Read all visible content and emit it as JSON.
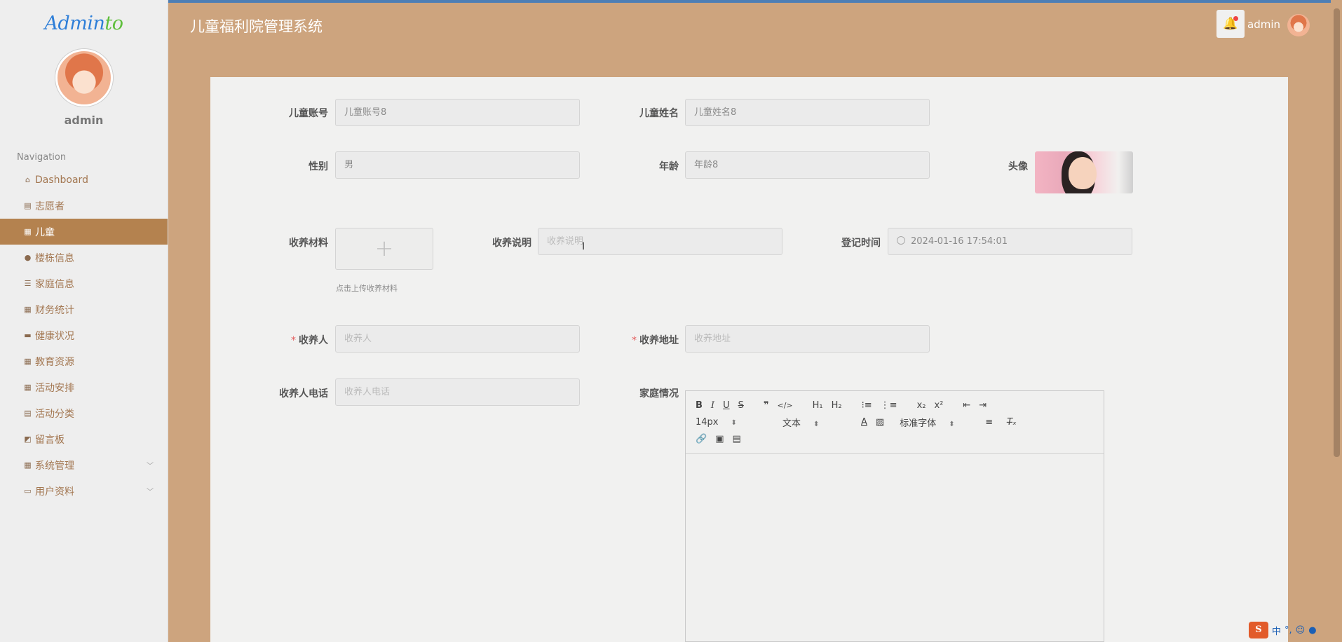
{
  "sidebar": {
    "logo_main": "Admin",
    "logo_suffix": "to",
    "user_name": "admin",
    "nav_title": "Navigation",
    "items": [
      {
        "label": "Dashboard",
        "icon": "home-icon"
      },
      {
        "label": "志愿者",
        "icon": "clipboard-icon"
      },
      {
        "label": "儿童",
        "icon": "grid-icon",
        "active": true
      },
      {
        "label": "楼栋信息",
        "icon": "user-icon"
      },
      {
        "label": "家庭信息",
        "icon": "sliders-icon"
      },
      {
        "label": "财务统计",
        "icon": "grid-icon"
      },
      {
        "label": "健康状况",
        "icon": "briefcase-icon"
      },
      {
        "label": "教育资源",
        "icon": "grid-icon"
      },
      {
        "label": "活动安排",
        "icon": "grid-icon"
      },
      {
        "label": "活动分类",
        "icon": "clipboard-icon"
      },
      {
        "label": "留言板",
        "icon": "chart-icon"
      },
      {
        "label": "系统管理",
        "icon": "grid-icon",
        "expandable": true
      },
      {
        "label": "用户资料",
        "icon": "card-icon",
        "expandable": true
      }
    ]
  },
  "header": {
    "title": "儿童福利院管理系统",
    "user": "admin"
  },
  "form": {
    "child_account": {
      "label": "儿童账号",
      "value": "儿童账号8"
    },
    "child_name": {
      "label": "儿童姓名",
      "value": "儿童姓名8"
    },
    "gender": {
      "label": "性别",
      "value": "男"
    },
    "age": {
      "label": "年龄",
      "value": "年龄8"
    },
    "avatar": {
      "label": "头像"
    },
    "adoption_material": {
      "label": "收养材料",
      "hint": "点击上传收养材料"
    },
    "adoption_note": {
      "label": "收养说明",
      "placeholder": "收养说明"
    },
    "register_time": {
      "label": "登记时间",
      "value": "2024-01-16 17:54:01"
    },
    "adopter": {
      "label": "收养人",
      "placeholder": "收养人",
      "required": true
    },
    "adopter_address": {
      "label": "收养地址",
      "placeholder": "收养地址",
      "required": true
    },
    "adopter_phone": {
      "label": "收养人电话",
      "placeholder": "收养人电话"
    },
    "family_situation": {
      "label": "家庭情况"
    }
  },
  "editor": {
    "font_size": "14px",
    "paragraph": "文本",
    "font_family": "标准字体"
  },
  "ime": {
    "mode": "中"
  }
}
